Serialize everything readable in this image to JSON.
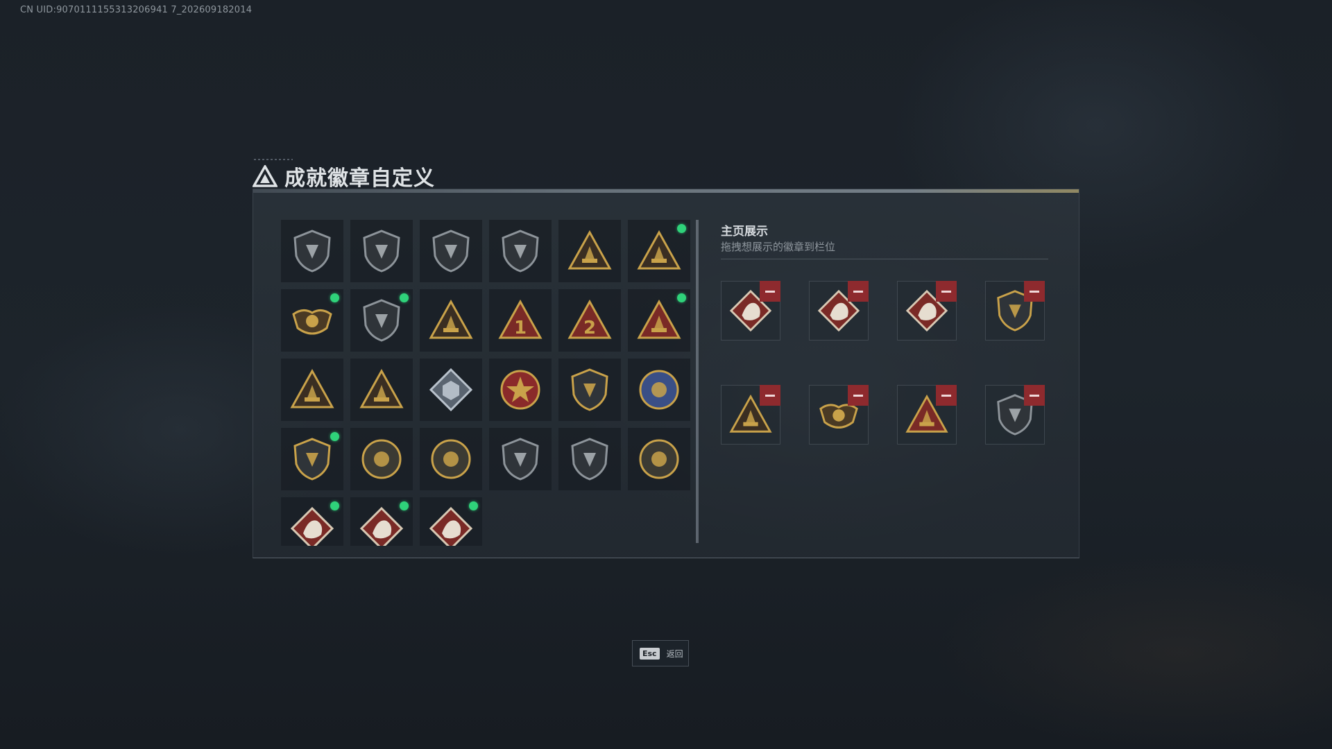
{
  "uid_text": "CN UID:9070111155313206941 7_202609182014",
  "title": "成就徽章自定义",
  "showcase": {
    "title": "主页展示",
    "subtitle": "拖拽想展示的徽章到栏位"
  },
  "esc": {
    "key": "Esc",
    "label": "返回"
  },
  "colors": {
    "new_dot": "#2fd27a",
    "remove": "#8e2a2e",
    "gold": "#c9a24a",
    "red_badge": "#7a2a26",
    "blue_badge": "#3a4f86"
  },
  "badges": [
    {
      "icon": "triangle-shield-badge-icon",
      "new": false
    },
    {
      "icon": "helicopter-shield-badge-icon",
      "new": false
    },
    {
      "icon": "emblem-shield-badge-icon",
      "new": false
    },
    {
      "icon": "arrow-shield-badge-icon",
      "new": false
    },
    {
      "icon": "crate-triangle-badge-icon",
      "new": false
    },
    {
      "icon": "turret-triangle-badge-icon",
      "new": true
    },
    {
      "icon": "winged-skull-badge-icon",
      "new": true
    },
    {
      "icon": "hooded-figure-badge-icon",
      "new": true
    },
    {
      "icon": "boat-triangle-badge-icon",
      "new": false
    },
    {
      "icon": "number-one-triangle-badge-icon",
      "new": false
    },
    {
      "icon": "number-two-triangle-badge-icon",
      "new": false
    },
    {
      "icon": "backpack-triangle-badge-icon",
      "new": true
    },
    {
      "icon": "soldier-triangle-badge-icon",
      "new": false
    },
    {
      "icon": "squad-triangle-badge-icon",
      "new": false
    },
    {
      "icon": "cube-diamond-badge-icon",
      "new": false
    },
    {
      "icon": "star-medal-badge-icon",
      "new": false
    },
    {
      "icon": "shield-crest-badge-icon",
      "new": false
    },
    {
      "icon": "blue-shield-badge-icon",
      "new": false
    },
    {
      "icon": "lion-shield-badge-icon",
      "new": true
    },
    {
      "icon": "skull-round-badge-icon",
      "new": false
    },
    {
      "icon": "sniper-round-badge-icon",
      "new": false
    },
    {
      "icon": "rifle-shield-badge-icon",
      "new": false
    },
    {
      "icon": "rifle-shield-dark-badge-icon",
      "new": false
    },
    {
      "icon": "gold-crest-badge-icon",
      "new": false
    },
    {
      "icon": "wolf-diamond-badge-icon",
      "new": true
    },
    {
      "icon": "dragon-diamond-badge-icon",
      "new": true
    },
    {
      "icon": "runner-diamond-badge-icon",
      "new": true
    }
  ],
  "showcase_slots": [
    {
      "icon": "wolf-diamond-badge-icon"
    },
    {
      "icon": "dragon-diamond-badge-icon"
    },
    {
      "icon": "runner-diamond-badge-icon"
    },
    {
      "icon": "lion-shield-badge-icon"
    },
    {
      "icon": "turret-triangle-badge-icon"
    },
    {
      "icon": "winged-skull-badge-icon"
    },
    {
      "icon": "backpack-triangle-badge-icon"
    },
    {
      "icon": "hooded-figure-badge-icon"
    }
  ]
}
